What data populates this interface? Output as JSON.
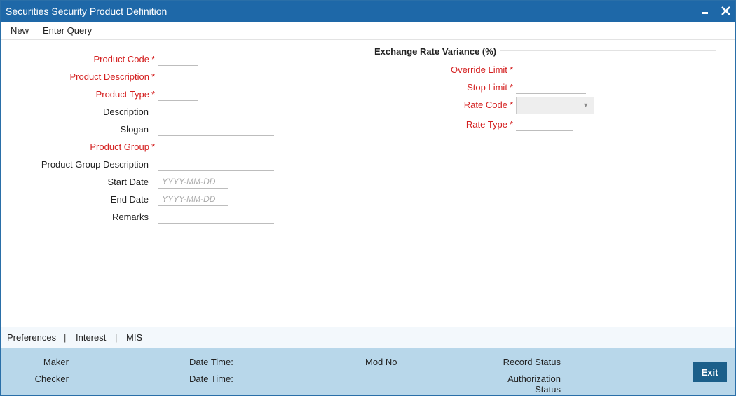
{
  "window": {
    "title": "Securities Security Product Definition"
  },
  "menu": {
    "new": "New",
    "enter_query": "Enter Query"
  },
  "form": {
    "product_code": {
      "label": "Product Code",
      "value": ""
    },
    "product_description": {
      "label": "Product Description",
      "value": ""
    },
    "product_type": {
      "label": "Product Type",
      "value": ""
    },
    "description": {
      "label": "Description",
      "value": ""
    },
    "slogan": {
      "label": "Slogan",
      "value": ""
    },
    "product_group": {
      "label": "Product Group",
      "value": ""
    },
    "product_group_description": {
      "label": "Product Group Description",
      "value": ""
    },
    "start_date": {
      "label": "Start Date",
      "value": "",
      "placeholder": "YYYY-MM-DD"
    },
    "end_date": {
      "label": "End Date",
      "value": "",
      "placeholder": "YYYY-MM-DD"
    },
    "remarks": {
      "label": "Remarks",
      "value": ""
    }
  },
  "exchange_rate": {
    "section_title": "Exchange Rate Variance (%)",
    "override_limit": {
      "label": "Override Limit",
      "value": ""
    },
    "stop_limit": {
      "label": "Stop Limit",
      "value": ""
    },
    "rate_code": {
      "label": "Rate Code",
      "selected": ""
    },
    "rate_type": {
      "label": "Rate Type",
      "value": ""
    }
  },
  "required_marker": "*",
  "subnav": {
    "tabs": [
      "Preferences",
      "Interest",
      "MIS"
    ],
    "separator": "|"
  },
  "footer": {
    "maker": "Maker",
    "checker": "Checker",
    "date_time_1": "Date Time:",
    "date_time_2": "Date Time:",
    "mod_no": "Mod No",
    "record_status": "Record Status",
    "authorization_status_line1": "Authorization",
    "authorization_status_line2": "Status",
    "exit": "Exit"
  },
  "colors": {
    "titlebar": "#1e68a8",
    "required_label": "#d42020",
    "footer": "#b8d7ea",
    "exit_button": "#1b5f8a"
  },
  "icons": {
    "minimize": "minimize-icon",
    "close": "close-icon",
    "dropdown": "chevron-down-icon"
  }
}
